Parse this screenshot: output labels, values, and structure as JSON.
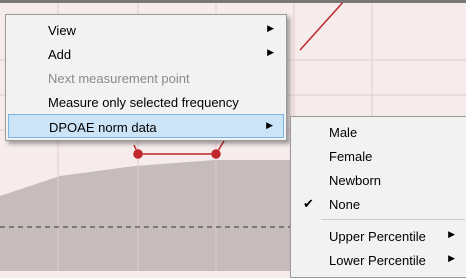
{
  "context_menu": {
    "items": [
      {
        "label": "View",
        "submenu": true,
        "enabled": true
      },
      {
        "label": "Add",
        "submenu": true,
        "enabled": true
      },
      {
        "label": "Next measurement point",
        "submenu": false,
        "enabled": false
      },
      {
        "label": "Measure only selected  frequency",
        "submenu": false,
        "enabled": true
      },
      {
        "label": "DPOAE norm data",
        "submenu": true,
        "enabled": true,
        "highlighted": true
      }
    ]
  },
  "norm_data_submenu": {
    "items": [
      {
        "label": "Male"
      },
      {
        "label": "Female"
      },
      {
        "label": "Newborn"
      },
      {
        "label": "None",
        "checked": true
      },
      {
        "label": "Upper Percentile",
        "submenu": true
      },
      {
        "label": "Lower Percentile",
        "submenu": true
      }
    ]
  },
  "icons": {
    "submenu_arrow": "▶",
    "checkmark": "✔"
  },
  "colors": {
    "plot_background": "#f6ecec",
    "norm_area": "#c6bcbc",
    "data_line": "#c0282d",
    "menu_background": "#f2f2f2",
    "highlight": "#cce4f7"
  }
}
